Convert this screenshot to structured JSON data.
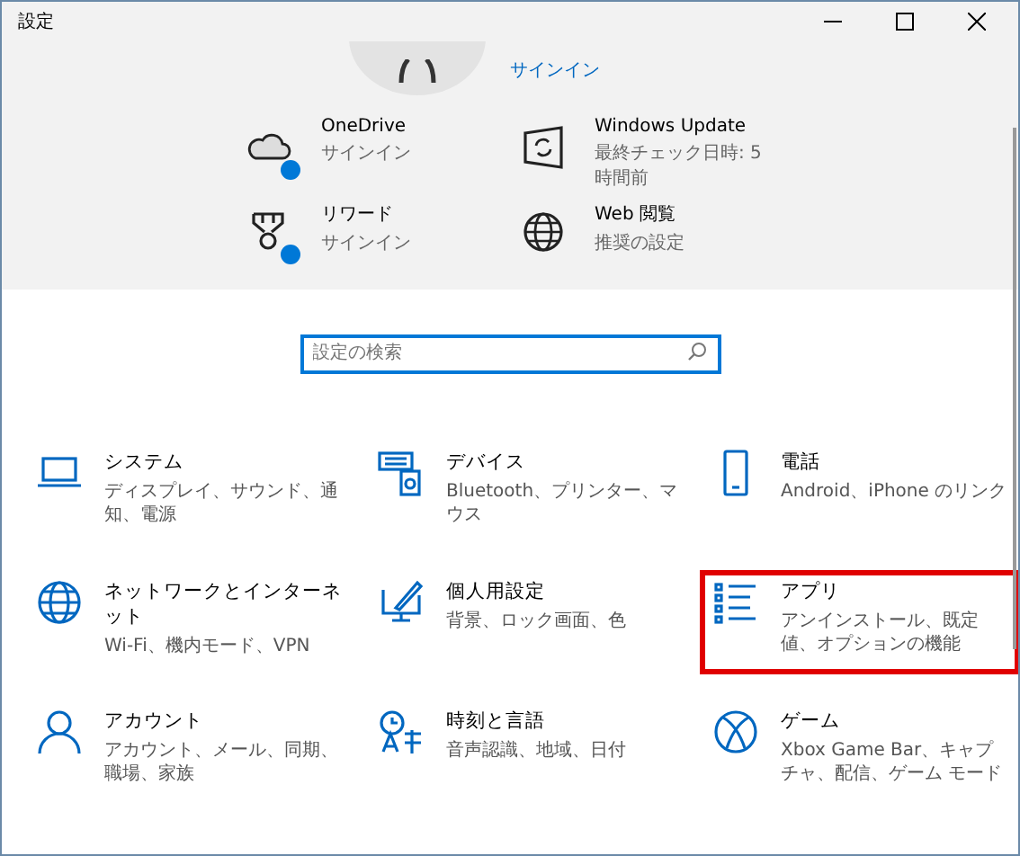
{
  "window": {
    "title": "設定"
  },
  "account": {
    "link": "サインイン"
  },
  "quick_links": [
    {
      "kind": "onedrive",
      "title": "OneDrive",
      "subtitle": "サインイン",
      "badge": true
    },
    {
      "kind": "update",
      "title": "Windows Update",
      "subtitle": "最終チェック日時: 5 時間前",
      "badge": false
    },
    {
      "kind": "rewards",
      "title": "リワード",
      "subtitle": "サインイン",
      "badge": true
    },
    {
      "kind": "web",
      "title": "Web 閲覧",
      "subtitle": "推奨の設定",
      "badge": false
    }
  ],
  "search": {
    "placeholder": "設定の検索"
  },
  "categories": [
    {
      "kind": "system",
      "title": "システム",
      "subtitle": "ディスプレイ、サウンド、通知、電源",
      "highlighted": false
    },
    {
      "kind": "devices",
      "title": "デバイス",
      "subtitle": "Bluetooth、プリンター、マウス",
      "highlighted": false
    },
    {
      "kind": "phone",
      "title": "電話",
      "subtitle": "Android、iPhone のリンク",
      "highlighted": false
    },
    {
      "kind": "network",
      "title": "ネットワークとインターネット",
      "subtitle": "Wi-Fi、機内モード、VPN",
      "highlighted": false
    },
    {
      "kind": "personal",
      "title": "個人用設定",
      "subtitle": "背景、ロック画面、色",
      "highlighted": false
    },
    {
      "kind": "apps",
      "title": "アプリ",
      "subtitle": "アンインストール、既定値、オプションの機能",
      "highlighted": true
    },
    {
      "kind": "accounts",
      "title": "アカウント",
      "subtitle": "アカウント、メール、同期、職場、家族",
      "highlighted": false
    },
    {
      "kind": "time",
      "title": "時刻と言語",
      "subtitle": "音声認識、地域、日付",
      "highlighted": false
    },
    {
      "kind": "gaming",
      "title": "ゲーム",
      "subtitle": "Xbox Game Bar、キャプチャ、配信、ゲーム モード",
      "highlighted": false
    }
  ]
}
